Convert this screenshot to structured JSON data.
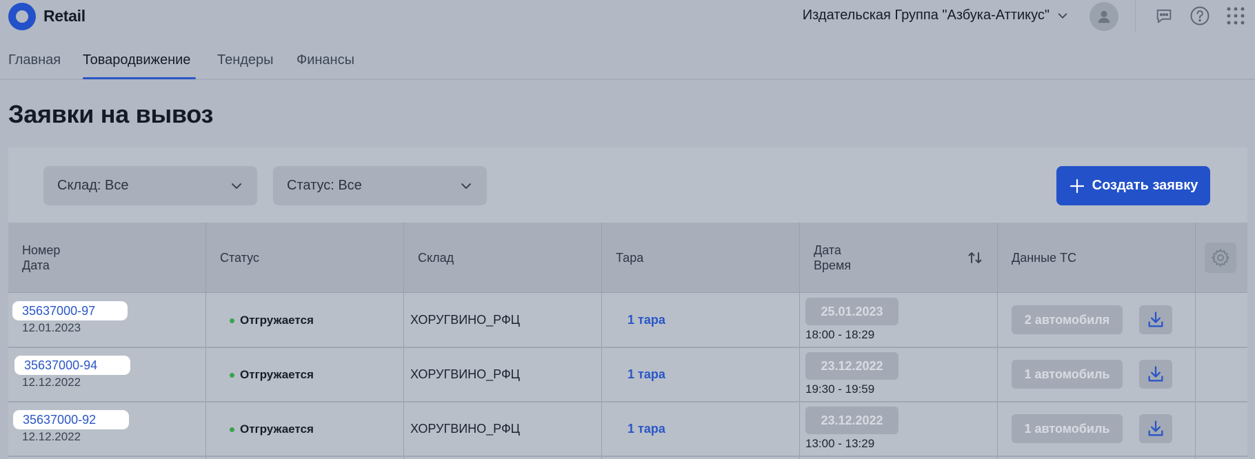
{
  "app": {
    "brand": "Retail"
  },
  "header": {
    "organization": "Издательская Группа \"Азбука-Аттикус\""
  },
  "nav": {
    "tabs": [
      {
        "label": "Главная"
      },
      {
        "label": "Товародвижение"
      },
      {
        "label": "Тендеры"
      },
      {
        "label": "Финансы"
      }
    ],
    "active": "Товародвижение"
  },
  "page": {
    "title": "Заявки на вывоз"
  },
  "filters": {
    "warehouse": "Склад: Все",
    "status": "Статус: Все"
  },
  "actions": {
    "create_label": "Создать заявку"
  },
  "table": {
    "columns": {
      "number_line1": "Номер",
      "number_line2": "Дата",
      "status": "Статус",
      "warehouse": "Склад",
      "tara": "Тара",
      "datetime_line1": "Дата",
      "datetime_line2": "Время",
      "vehicle": "Данные ТС"
    },
    "rows": [
      {
        "number": "35637000-97",
        "date": "12.01.2023",
        "status": "Отгружается",
        "warehouse": "ХОРУГВИНО_РФЦ",
        "tara": "1 тара",
        "ship_date": "25.01.2023",
        "ship_time": "18:00 - 18:29",
        "vehicles": "2 автомобиля"
      },
      {
        "number": "35637000-94",
        "date": "12.12.2022",
        "status": "Отгружается",
        "warehouse": "ХОРУГВИНО_РФЦ",
        "tara": "1 тара",
        "ship_date": "23.12.2022",
        "ship_time": "19:30 - 19:59",
        "vehicles": "1 автомобиль"
      },
      {
        "number": "35637000-92",
        "date": "12.12.2022",
        "status": "Отгружается",
        "warehouse": "ХОРУГВИНО_РФЦ",
        "tara": "1 тара",
        "ship_date": "23.12.2022",
        "ship_time": "13:00 - 13:29",
        "vehicles": "1 автомобиль"
      }
    ]
  },
  "colors": {
    "accent": "#2351c9",
    "link": "#2a56c6",
    "status_dot": "#3aa34f",
    "overlay_bg": "#b2b9c4"
  }
}
